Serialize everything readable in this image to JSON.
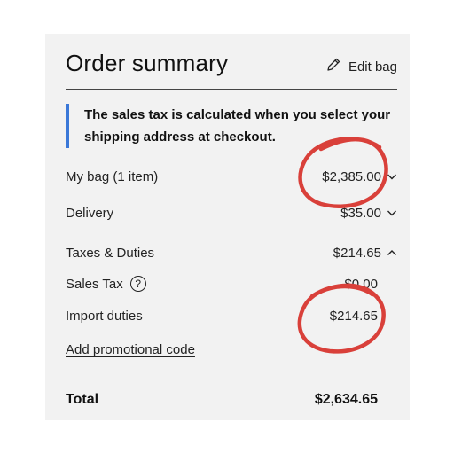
{
  "summary": {
    "title": "Order summary",
    "edit_label": "Edit bag",
    "notice": "The sales tax is calculated when you select your shipping address at checkout.",
    "rows": {
      "bag": {
        "label": "My bag (1 item)",
        "value": "$2,385.00",
        "chevron": "chevron-down-icon"
      },
      "delivery": {
        "label": "Delivery",
        "value": "$35.00",
        "chevron": "chevron-down-icon"
      },
      "taxes": {
        "label": "Taxes & Duties",
        "value": "$214.65",
        "chevron": "chevron-up-icon"
      },
      "sales_tax": {
        "label": "Sales Tax",
        "value": "$0.00",
        "help": "?"
      },
      "import_duties": {
        "label": "Import duties",
        "value": "$214.65"
      }
    },
    "promo_label": "Add promotional code",
    "total_label": "Total",
    "total_value": "$2,634.65"
  },
  "colors": {
    "accent_bar": "#3b78d8",
    "annotation": "#d9403a",
    "card_bg": "#f2f2f2"
  }
}
